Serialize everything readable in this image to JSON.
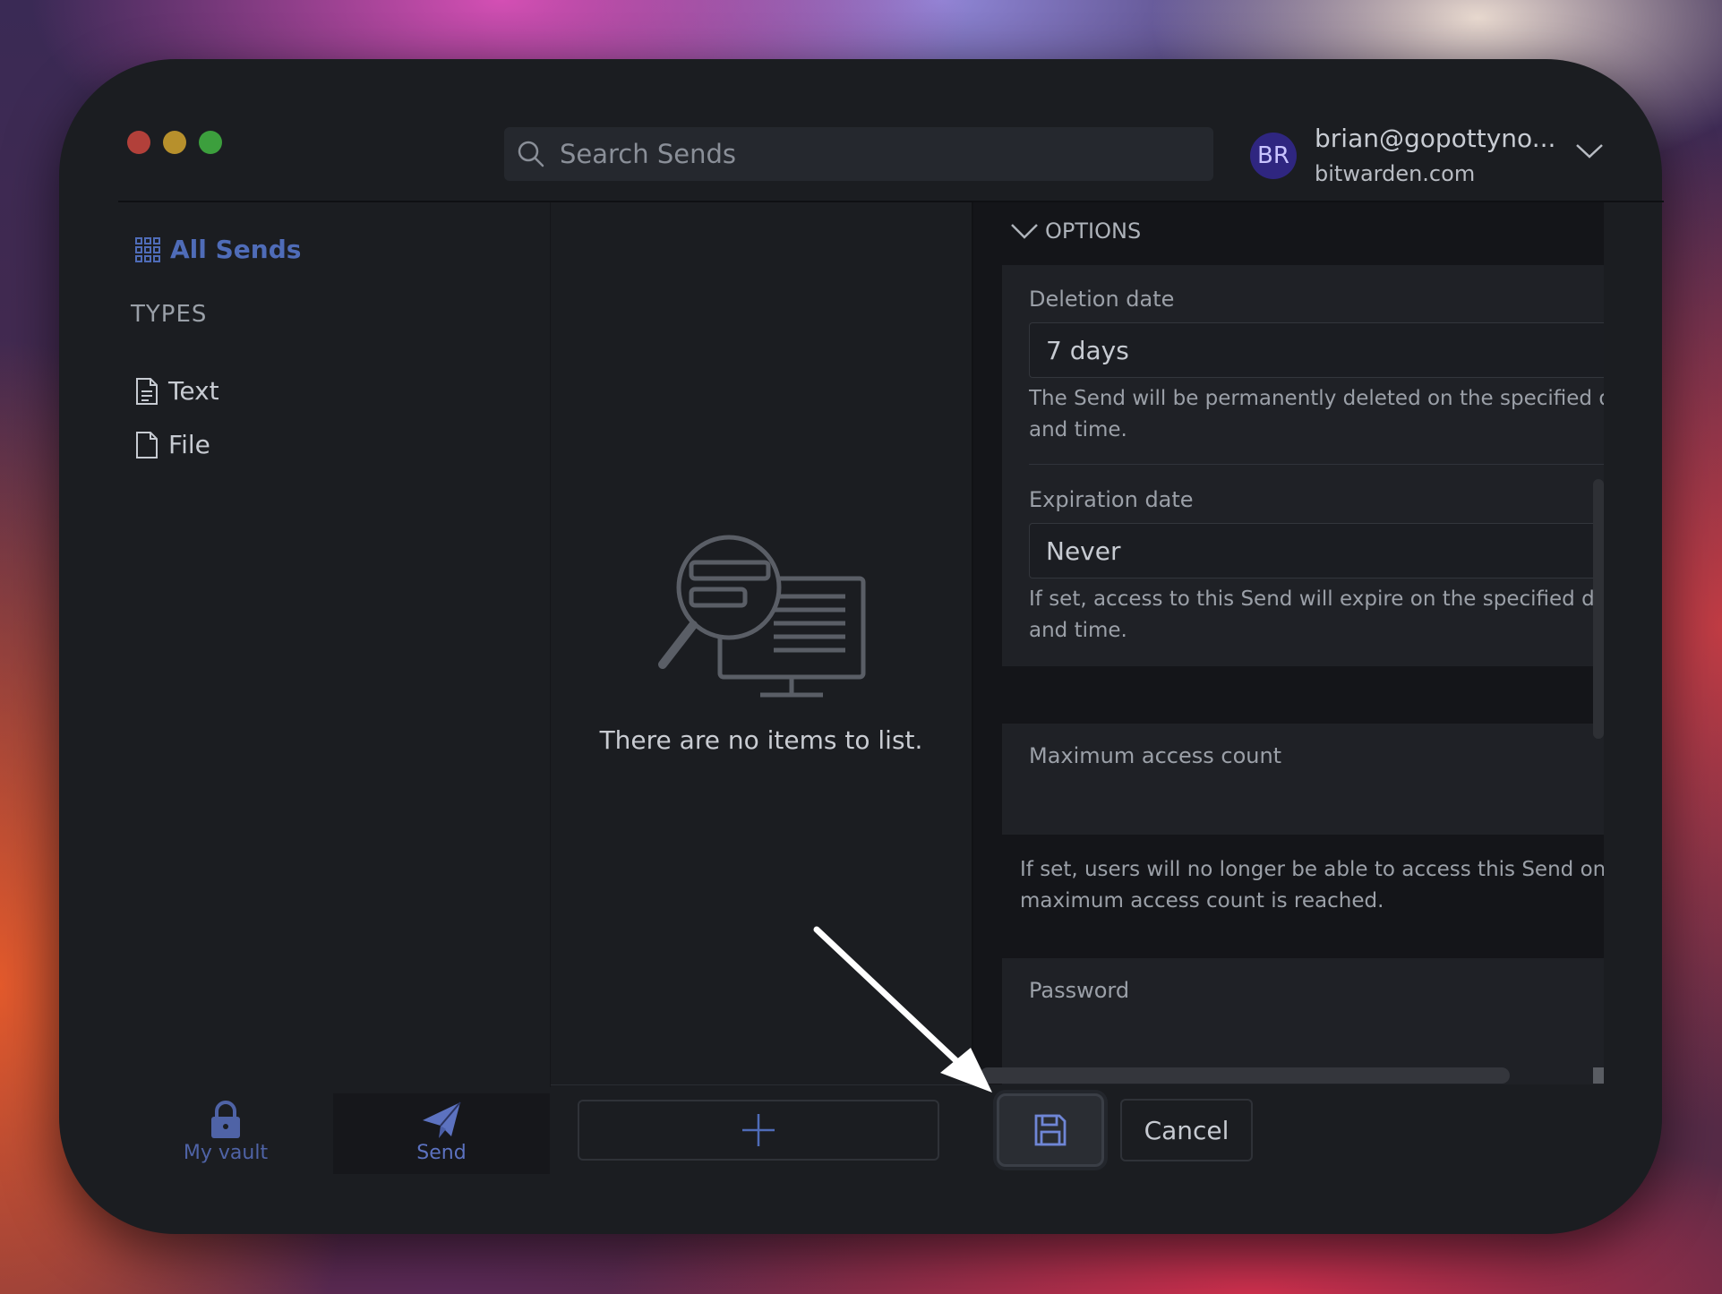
{
  "search": {
    "placeholder": "Search Sends"
  },
  "account": {
    "initials": "BR",
    "email": "brian@gopottyno...",
    "host": "bitwarden.com"
  },
  "sidebar": {
    "all_sends": "All Sends",
    "types_heading": "TYPES",
    "types": [
      {
        "label": "Text",
        "icon": "text-file-icon"
      },
      {
        "label": "File",
        "icon": "file-icon"
      }
    ]
  },
  "bottom_nav": {
    "vault": "My vault",
    "send": "Send"
  },
  "list": {
    "empty_message": "There are no items to list."
  },
  "options": {
    "heading": "OPTIONS",
    "deletion": {
      "label": "Deletion date",
      "value": "7 days",
      "help_1": "The Send will be permanently deleted on the specified da",
      "help_2": "and time."
    },
    "expiration": {
      "label": "Expiration date",
      "value": "Never",
      "help_1": "If set, access to this Send will expire on the specified date",
      "help_2": "and time."
    },
    "max_access": {
      "label": "Maximum access count",
      "help_1": "If set, users will no longer be able to access this Send once",
      "help_2": "maximum access count is reached."
    },
    "password": {
      "label": "Password"
    }
  },
  "toolbar": {
    "cancel_label": "Cancel"
  },
  "colors": {
    "accent": "#4f6cb8",
    "window_bg": "#1b1d21",
    "detail_bg": "#141519"
  }
}
